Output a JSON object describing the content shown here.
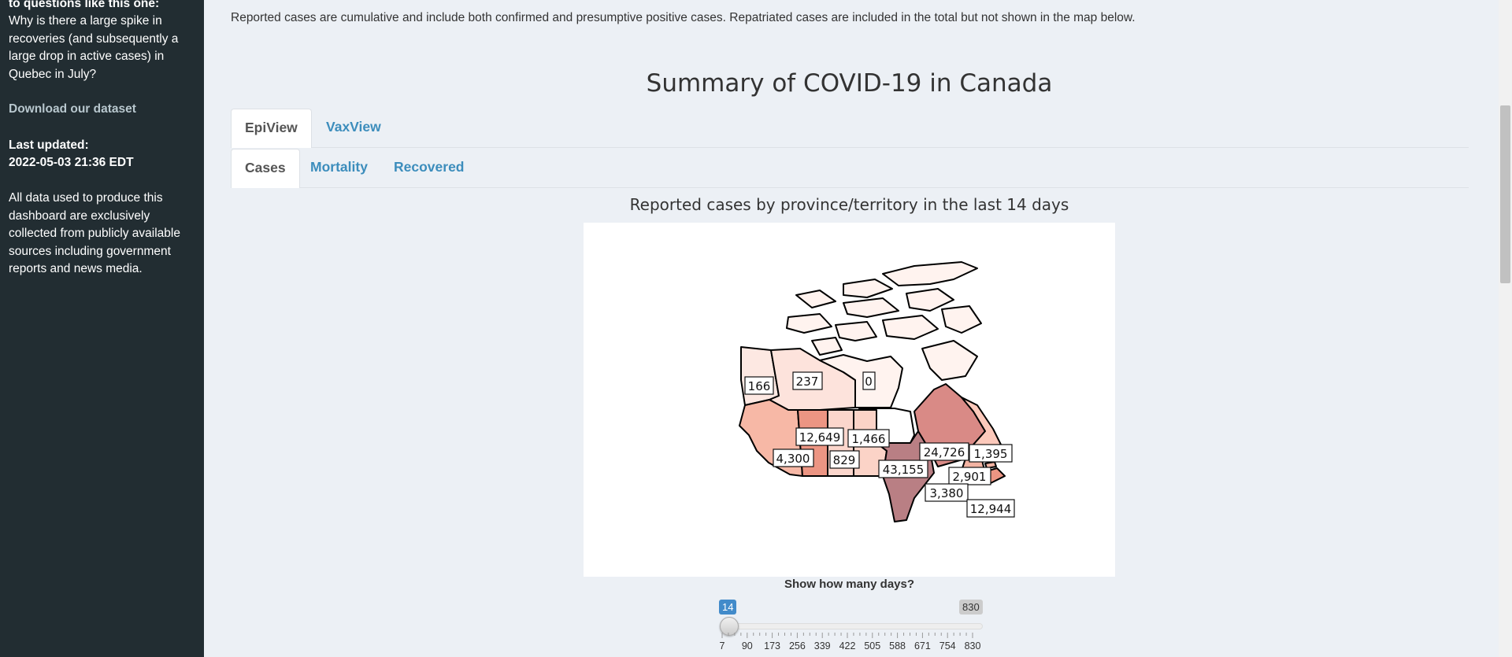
{
  "sidebar": {
    "top_fragment": "to questions like this one:",
    "question": "Why is there a large spike in recoveries (and subsequently a large drop in active cases) in Quebec in July?",
    "download_link": "Download our dataset",
    "last_updated_label": "Last updated:",
    "last_updated_value": "2022-05-03 21:36 EDT",
    "disclaimer": "All data used to produce this dashboard are exclusively collected from publicly available sources including government reports and news media."
  },
  "notice": "Reported cases are cumulative and include both confirmed and presumptive positive cases. Repatriated cases are included in the total but not shown in the map below.",
  "page_title": "Summary of COVID-19 in Canada",
  "main_tabs": [
    {
      "label": "EpiView",
      "active": true
    },
    {
      "label": "VaxView",
      "active": false
    }
  ],
  "sub_tabs": [
    {
      "label": "Cases",
      "active": true
    },
    {
      "label": "Mortality",
      "active": false
    },
    {
      "label": "Recovered",
      "active": false
    }
  ],
  "map": {
    "title": "Reported cases by province/territory in the last 14 days",
    "regions": [
      {
        "name": "Yukon",
        "value": "166",
        "color": "#fde8e2"
      },
      {
        "name": "Northwest Territories",
        "value": "237",
        "color": "#fde3dc"
      },
      {
        "name": "Nunavut",
        "value": "0",
        "color": "#fff3ef"
      },
      {
        "name": "British Columbia",
        "value": "4,300",
        "color": "#f7b8a6"
      },
      {
        "name": "Alberta",
        "value": "12,649",
        "color": "#ec9583"
      },
      {
        "name": "Saskatchewan",
        "value": "829",
        "color": "#fbd6cc"
      },
      {
        "name": "Manitoba",
        "value": "1,466",
        "color": "#fbd3c7"
      },
      {
        "name": "Ontario",
        "value": "43,155",
        "color": "#b97f84"
      },
      {
        "name": "Quebec",
        "value": "24,726",
        "color": "#d98a86"
      },
      {
        "name": "Newfoundland and Labrador",
        "value": "1,395",
        "color": "#fcc9bb"
      },
      {
        "name": "New Brunswick",
        "value": "2,901",
        "color": "#f3b3a2"
      },
      {
        "name": "Prince Edward Island",
        "value": "3,380",
        "color": "#f3b3a2"
      },
      {
        "name": "Nova Scotia",
        "value": "12,944",
        "color": "#ec9583"
      }
    ]
  },
  "slider": {
    "label": "Show how many days?",
    "value": "14",
    "max_value": "830",
    "tick_labels": [
      "7",
      "90",
      "173",
      "256",
      "339",
      "422",
      "505",
      "588",
      "671",
      "754",
      "830"
    ]
  }
}
